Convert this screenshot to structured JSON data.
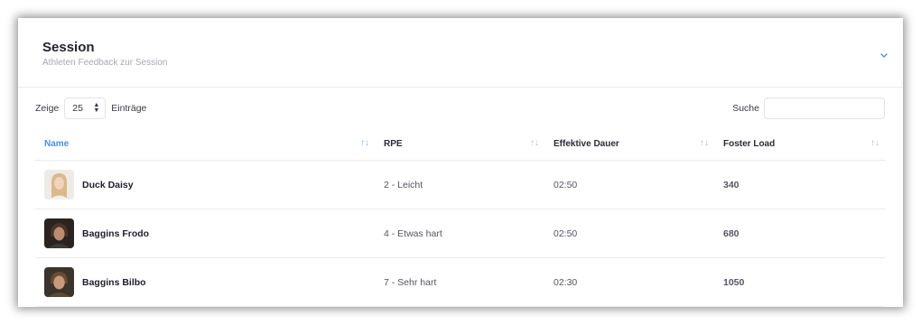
{
  "card": {
    "title": "Session",
    "subtitle": "Athleten Feedback zur Session",
    "toggle_icon": "chevron-down-icon"
  },
  "controls": {
    "show_prefix": "Zeige",
    "page_length": "25",
    "show_suffix": "Einträge",
    "search_label": "Suche",
    "search_value": ""
  },
  "table": {
    "columns": [
      "Name",
      "RPE",
      "Effektive Dauer",
      "Foster Load"
    ],
    "rows": [
      {
        "name": "Duck Daisy",
        "rpe": "2 - Leicht",
        "duration": "02:50",
        "load": "340"
      },
      {
        "name": "Baggins Frodo",
        "rpe": "4 - Etwas hart",
        "duration": "02:50",
        "load": "680"
      },
      {
        "name": "Baggins Bilbo",
        "rpe": "7 - Sehr hart",
        "duration": "02:30",
        "load": "1050"
      }
    ]
  },
  "colors": {
    "accent": "#4a90e2",
    "sort_icon": "#b9b9c6"
  }
}
